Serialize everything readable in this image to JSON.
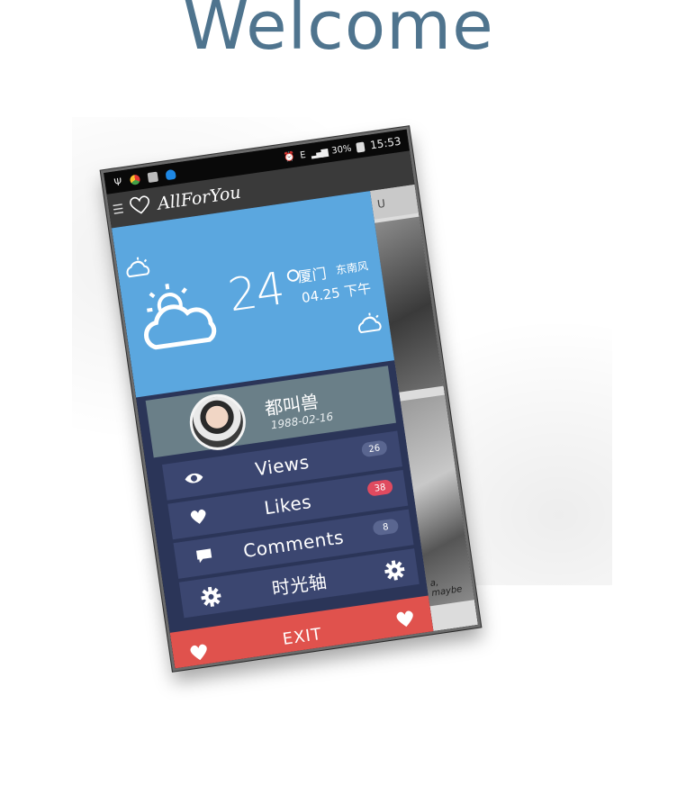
{
  "page": {
    "heading": "Welcome"
  },
  "app": {
    "title": "AllForYou"
  },
  "status_bar": {
    "network": "E",
    "battery": "30%",
    "time": "15:53"
  },
  "weather": {
    "temperature": "24°",
    "city": "厦门",
    "wind": "东南风",
    "datetime": "04.25 下午"
  },
  "profile": {
    "name": "都叫兽",
    "birthday": "1988-02-16"
  },
  "menu": [
    {
      "label": "Views",
      "count": "26",
      "icon": "eye-icon"
    },
    {
      "label": "Likes",
      "count": "38",
      "icon": "heart-icon"
    },
    {
      "label": "Comments",
      "count": "8",
      "icon": "comment-icon"
    },
    {
      "label": "时光轴",
      "icon": "gear-icon"
    }
  ],
  "exit": {
    "label": "EXIT"
  },
  "content": {
    "tab": "U",
    "caption": "a, maybe"
  },
  "colors": {
    "heading": "#3d6682",
    "weather_bg": "#5ba7df",
    "drawer_bg": "#2b3558",
    "menu_item_bg": "#3b4670",
    "profile_bg": "#6a7f88",
    "exit_bg": "#e0524d",
    "likes_badge": "#e04a5f"
  }
}
